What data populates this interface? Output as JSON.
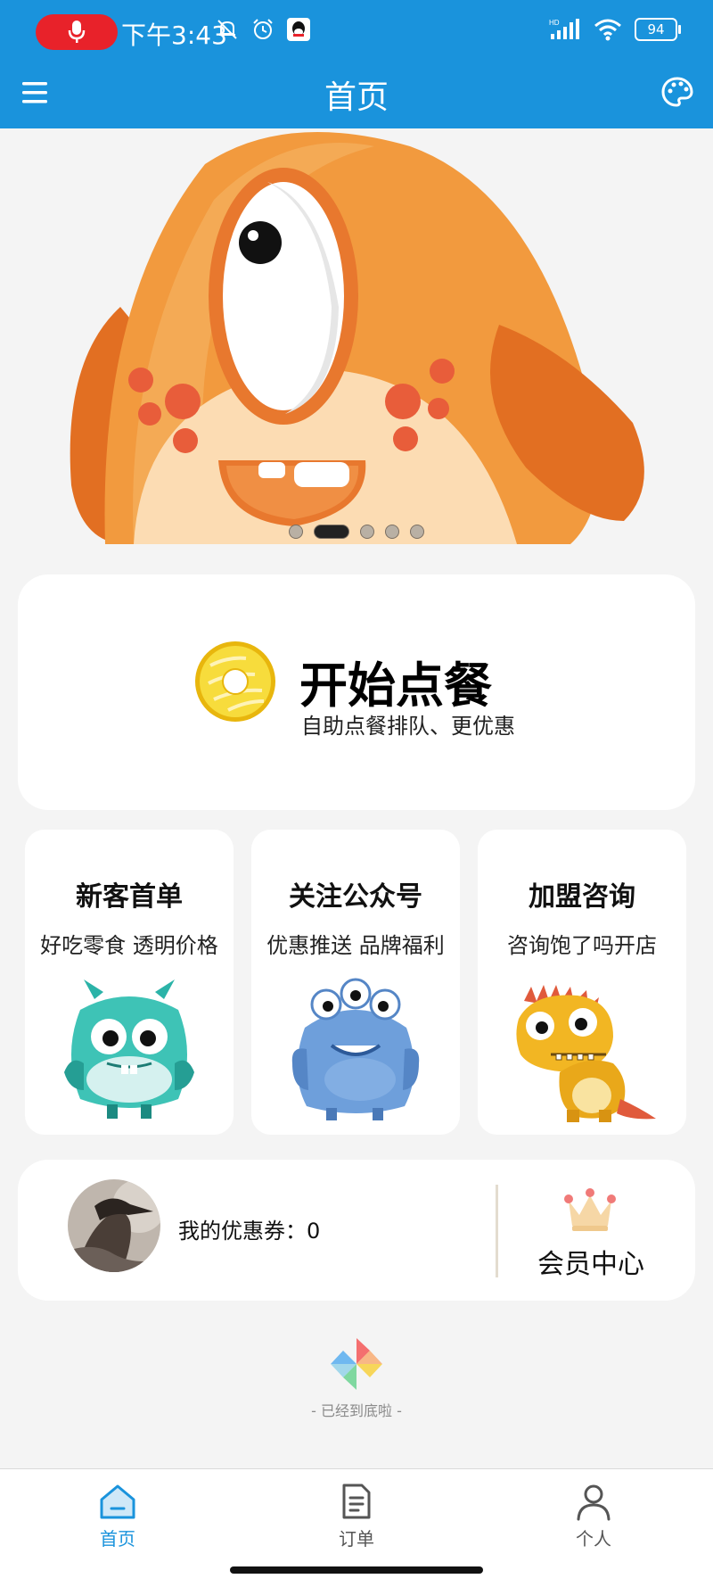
{
  "status_bar": {
    "time": "下午3:43",
    "battery": "94",
    "network_badge": "HD"
  },
  "header": {
    "title": "首页",
    "menu_icon": "menu-icon",
    "right_icon": "palette-icon",
    "bg_color": "#1a93dc"
  },
  "banner": {
    "slide_count": 5,
    "active_index": 1
  },
  "order_card": {
    "title": "开始点餐",
    "subtitle": "自助点餐排队、更优惠"
  },
  "tiles": [
    {
      "title": "新客首单",
      "subtitle": "好吃零食 透明价格",
      "icon": "teal-monster-icon"
    },
    {
      "title": "关注公众号",
      "subtitle": "优惠推送 品牌福利",
      "icon": "blue-monster-icon"
    },
    {
      "title": "加盟咨询",
      "subtitle": "咨询饱了吗开店",
      "icon": "yellow-dino-icon"
    }
  ],
  "member_card": {
    "coupon_text": "我的优惠券：0",
    "member_center": "会员中心"
  },
  "footer_note": "- 已经到底啦 -",
  "tabbar": {
    "items": [
      {
        "label": "首页",
        "icon": "home-icon",
        "active": true
      },
      {
        "label": "订单",
        "icon": "order-icon",
        "active": false
      },
      {
        "label": "个人",
        "icon": "profile-icon",
        "active": false
      }
    ],
    "active_color": "#1a93dc"
  }
}
